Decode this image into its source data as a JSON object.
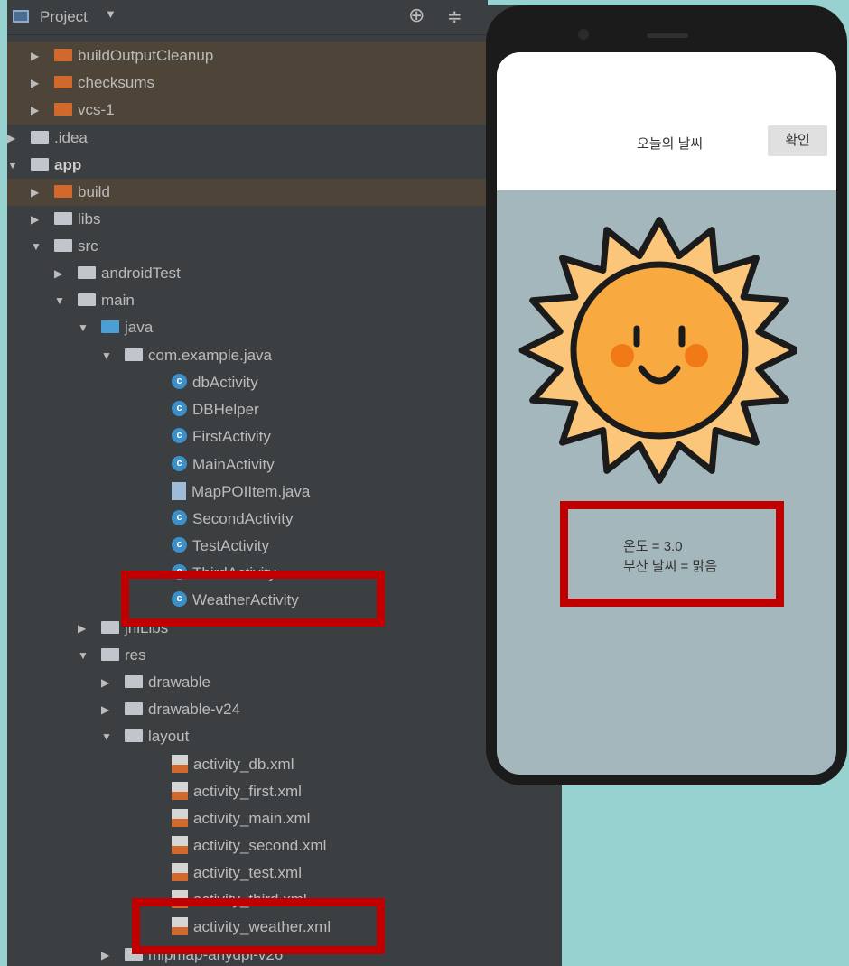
{
  "panel": {
    "title": "Project",
    "caret": "▼",
    "locate": "⊕",
    "collapse": "≑"
  },
  "tree": [
    {
      "label": "buildOutputCleanup",
      "arrow": "▶",
      "icon": "folder-orange"
    },
    {
      "label": "checksums",
      "arrow": "▶",
      "icon": "folder-orange"
    },
    {
      "label": "vcs-1",
      "arrow": "▶",
      "icon": "folder-orange"
    },
    {
      "label": ".idea",
      "arrow": "▶",
      "icon": "folder"
    },
    {
      "label": "app",
      "arrow": "▼",
      "icon": "folder-module"
    },
    {
      "label": "build",
      "arrow": "▶",
      "icon": "folder-orange"
    },
    {
      "label": "libs",
      "arrow": "▶",
      "icon": "folder"
    },
    {
      "label": "src",
      "arrow": "▼",
      "icon": "folder"
    },
    {
      "label": "androidTest",
      "arrow": "▶",
      "icon": "folder"
    },
    {
      "label": "main",
      "arrow": "▼",
      "icon": "folder"
    },
    {
      "label": "java",
      "arrow": "▼",
      "icon": "folder-blue"
    },
    {
      "label": "com.example.java",
      "arrow": "▼",
      "icon": "package"
    },
    {
      "label": "dbActivity",
      "arrow": "",
      "icon": "class"
    },
    {
      "label": "DBHelper",
      "arrow": "",
      "icon": "class"
    },
    {
      "label": "FirstActivity",
      "arrow": "",
      "icon": "class"
    },
    {
      "label": "MainActivity",
      "arrow": "",
      "icon": "class"
    },
    {
      "label": "MapPOIItem.java",
      "arrow": "",
      "icon": "java-file"
    },
    {
      "label": "SecondActivity",
      "arrow": "",
      "icon": "class"
    },
    {
      "label": "TestActivity",
      "arrow": "",
      "icon": "class"
    },
    {
      "label": "ThirdActivity",
      "arrow": "",
      "icon": "class"
    },
    {
      "label": "WeatherActivity",
      "arrow": "",
      "icon": "class"
    },
    {
      "label": "jniLibs",
      "arrow": "▶",
      "icon": "folder"
    },
    {
      "label": "res",
      "arrow": "▼",
      "icon": "folder-res"
    },
    {
      "label": "drawable",
      "arrow": "▶",
      "icon": "folder"
    },
    {
      "label": "drawable-v24",
      "arrow": "▶",
      "icon": "folder"
    },
    {
      "label": "layout",
      "arrow": "▼",
      "icon": "folder"
    },
    {
      "label": "activity_db.xml",
      "arrow": "",
      "icon": "xml-file"
    },
    {
      "label": "activity_first.xml",
      "arrow": "",
      "icon": "xml-file"
    },
    {
      "label": "activity_main.xml",
      "arrow": "",
      "icon": "xml-file"
    },
    {
      "label": "activity_second.xml",
      "arrow": "",
      "icon": "xml-file"
    },
    {
      "label": "activity_test.xml",
      "arrow": "",
      "icon": "xml-file"
    },
    {
      "label": "activity_third.xml",
      "arrow": "",
      "icon": "xml-file"
    },
    {
      "label": "activity_weather.xml",
      "arrow": "",
      "icon": "xml-file"
    },
    {
      "label": "mipmap-anydpi-v26",
      "arrow": "▶",
      "icon": "folder"
    }
  ],
  "app": {
    "title": "오늘의 날씨",
    "confirm_button": "확인",
    "temperature": "온도 = 3.0",
    "weather": "부산 날씨 = 맑음",
    "image": "sun-smiling-icon"
  },
  "colors": {
    "panel_bg": "#3c3f41",
    "highlight": "#c00000",
    "screen_bg": "#a3b7bc"
  }
}
